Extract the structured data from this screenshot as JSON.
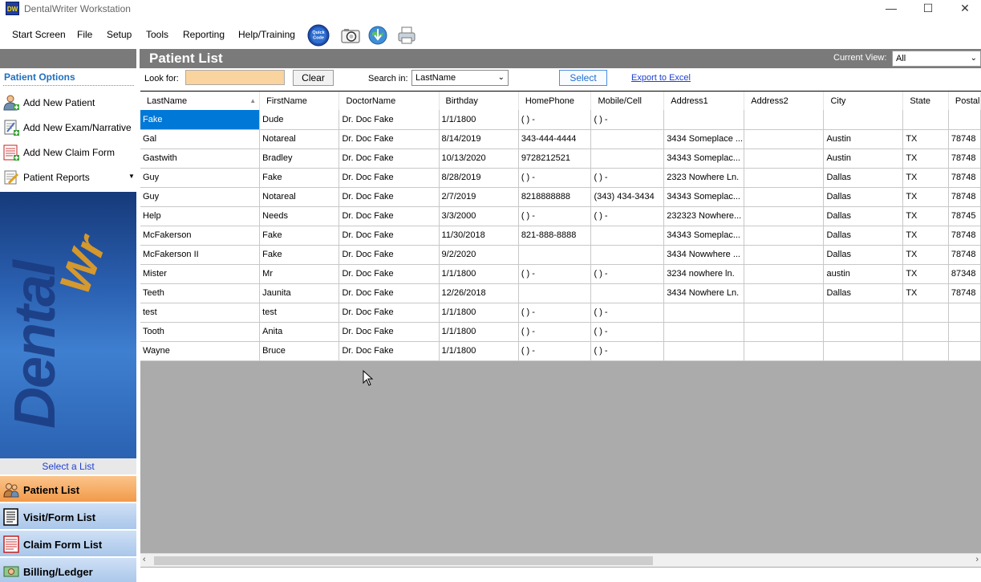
{
  "window": {
    "title": "DentalWriter Workstation",
    "icon_text": "DW"
  },
  "menu": {
    "items": [
      "Start Screen",
      "File",
      "Setup",
      "Tools",
      "Reporting",
      "Help/Training"
    ],
    "quick_code_label": "Quick Code"
  },
  "sidebar": {
    "options_title": "Patient Options",
    "options": [
      {
        "label": "Add New Patient",
        "icon": "add-patient-icon"
      },
      {
        "label": "Add New Exam/Narrative",
        "icon": "add-exam-icon"
      },
      {
        "label": "Add New Claim Form",
        "icon": "add-claim-icon"
      },
      {
        "label": "Patient Reports",
        "icon": "reports-icon"
      }
    ],
    "select_list_label": "Select a List",
    "lists": [
      {
        "label": "Patient List",
        "active": true
      },
      {
        "label": "Visit/Form List",
        "active": false
      },
      {
        "label": "Claim Form List",
        "active": false
      },
      {
        "label": "Billing/Ledger",
        "active": false
      }
    ]
  },
  "main": {
    "title": "Patient List",
    "current_view_label": "Current View:",
    "current_view_value": "All",
    "look_for_label": "Look for:",
    "look_for_value": "",
    "clear_label": "Clear",
    "search_in_label": "Search in:",
    "search_in_value": "LastName",
    "select_label": "Select",
    "export_label": "Export to Excel"
  },
  "grid": {
    "columns": [
      "LastName",
      "FirstName",
      "DoctorName",
      "Birthday",
      "HomePhone",
      "Mobile/Cell",
      "Address1",
      "Address2",
      "City",
      "State",
      "Postal"
    ],
    "rows": [
      [
        "Fake",
        "Dude",
        "Dr. Doc Fake",
        "1/1/1800",
        "(  )   -",
        "(  )   -",
        "",
        "",
        "",
        "",
        ""
      ],
      [
        "Gal",
        "Notareal",
        "Dr. Doc Fake",
        "8/14/2019",
        "343-444-4444",
        "",
        "3434 Someplace ...",
        "",
        "Austin",
        "TX",
        "78748"
      ],
      [
        "Gastwith",
        "Bradley",
        "Dr. Doc Fake",
        "10/13/2020",
        "9728212521",
        "",
        "34343 Someplac...",
        "",
        "Austin",
        "TX",
        "78748"
      ],
      [
        "Guy",
        "Fake",
        "Dr. Doc Fake",
        "8/28/2019",
        "(  )   -",
        "(  )   -",
        "2323 Nowhere Ln.",
        "",
        "Dallas",
        "TX",
        "78748"
      ],
      [
        "Guy",
        "Notareal",
        "Dr. Doc Fake",
        "2/7/2019",
        "8218888888",
        "(343) 434-3434",
        "34343 Someplac...",
        "",
        "Dallas",
        "TX",
        "78748"
      ],
      [
        "Help",
        "Needs",
        "Dr. Doc Fake",
        "3/3/2000",
        "(  )   -",
        "(  )   -",
        "232323 Nowhere...",
        "",
        "Dallas",
        "TX",
        "78745"
      ],
      [
        "McFakerson",
        "Fake",
        "Dr. Doc Fake",
        "11/30/2018",
        "821-888-8888",
        "",
        "34343 Someplac...",
        "",
        "Dallas",
        "TX",
        "78748"
      ],
      [
        "McFakerson II",
        "Fake",
        "Dr. Doc Fake",
        "9/2/2020",
        "",
        "",
        "3434 Nowwhere ...",
        "",
        "Dallas",
        "TX",
        "78748"
      ],
      [
        "Mister",
        "Mr",
        "Dr. Doc Fake",
        "1/1/1800",
        "(  )   -",
        "(  )   -",
        "3234 nowhere ln.",
        "",
        "austin",
        "TX",
        "87348"
      ],
      [
        "Teeth",
        "Jaunita",
        "Dr. Doc Fake",
        "12/26/2018",
        "",
        "",
        "3434 Nowhere Ln.",
        "",
        "Dallas",
        "TX",
        "78748"
      ],
      [
        "test",
        "test",
        "Dr. Doc Fake",
        "1/1/1800",
        "(  )   -",
        "(  )   -",
        "",
        "",
        "",
        "",
        ""
      ],
      [
        "Tooth",
        "Anita",
        "Dr. Doc Fake",
        "1/1/1800",
        "(  )   -",
        "(  )   -",
        "",
        "",
        "",
        "",
        ""
      ],
      [
        "Wayne",
        "Bruce",
        "Dr. Doc Fake",
        "1/1/1800",
        "(  )   -",
        "(  )   -",
        "",
        "",
        "",
        "",
        ""
      ]
    ]
  },
  "colors": {
    "selected_cell": "#0078d7",
    "header_bar": "#7a7a7a",
    "active_list_button": "#f29a4a",
    "lookfor_input": "#f9d49e"
  }
}
